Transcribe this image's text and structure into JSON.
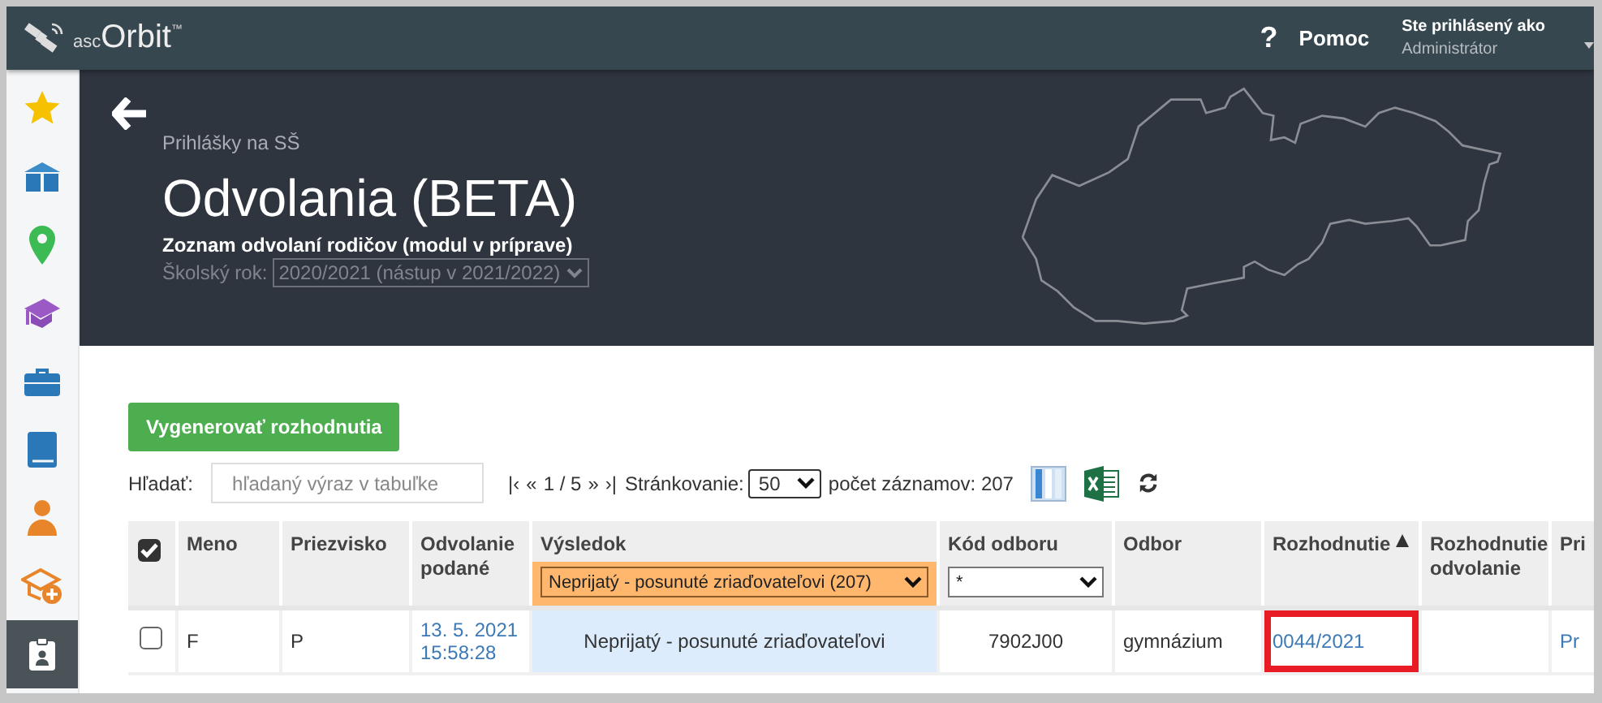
{
  "logo": {
    "prefix": "asc",
    "name": "Orbit",
    "mark": "™"
  },
  "topbar": {
    "help": {
      "icon_char": "?",
      "label": "Pomoc"
    },
    "user": {
      "caption": "Ste prihlásený ako",
      "name": "Administrátor"
    }
  },
  "sidebar": {
    "items": [
      {
        "kind": "star",
        "selected": false
      },
      {
        "kind": "book-open",
        "selected": false
      },
      {
        "kind": "pin",
        "selected": false
      },
      {
        "kind": "cap",
        "selected": false
      },
      {
        "kind": "briefcase",
        "selected": false
      },
      {
        "kind": "book",
        "selected": false
      },
      {
        "kind": "person",
        "selected": false
      },
      {
        "kind": "cap-plus",
        "selected": false
      },
      {
        "kind": "clipboard",
        "selected": true
      }
    ]
  },
  "header": {
    "breadcrumb": "Prihlášky na SŠ",
    "title": "Odvolania (BETA)",
    "subtitle": "Zoznam odvolaní rodičov (modul v príprave)",
    "school_year": {
      "label": "Školský rok:",
      "value": "2020/2021 (nástup v 2021/2022)",
      "disabled": true
    }
  },
  "toolbar": {
    "generate_button": "Vygenerovať rozhodnutia",
    "search": {
      "label": "Hľadať:",
      "placeholder": "hľadaný výraz v tabuľke"
    },
    "pager": {
      "first": "|‹",
      "prev": "«",
      "page": "1 / 5",
      "next": "»",
      "last": "›|"
    },
    "page_size": {
      "label": "Stránkovanie:",
      "value": "50"
    },
    "count": "počet záznamov: 207"
  },
  "table": {
    "select_all_checked": true,
    "columns": [
      {
        "label": "Meno",
        "kind": "text",
        "sorted": false
      },
      {
        "label": "Priezvisko",
        "kind": "text",
        "sorted": false
      },
      {
        "label": "Odvolanie podané",
        "kind": "link",
        "sorted": false
      },
      {
        "label": "Výsledok",
        "kind": "text",
        "sorted": false,
        "filter": {
          "value": "Neprijatý - posunuté zriaďovateľovi (207)",
          "active": true
        }
      },
      {
        "label": "Kód odboru",
        "kind": "code",
        "sorted": false,
        "filter": {
          "value": "*",
          "active": false
        }
      },
      {
        "label": "Odbor",
        "kind": "text",
        "sorted": false
      },
      {
        "label": "Rozhodnutie",
        "kind": "link",
        "sorted": true
      },
      {
        "label": "Rozhodnutie odvolanie",
        "kind": "text",
        "sorted": false
      },
      {
        "label": "Pri",
        "kind": "link",
        "sorted": false
      }
    ],
    "rows": [
      {
        "checked": false,
        "cells": [
          {
            "text": "F"
          },
          {
            "text": "P"
          },
          {
            "lines": [
              "13. 5. 2021",
              "15:58:28"
            ]
          },
          {
            "text": "Neprijatý - posunuté zriaďovateľovi"
          },
          {
            "text": "7902J00"
          },
          {
            "text": "gymnázium"
          },
          {
            "text": "0044/2021",
            "highlighted": true
          },
          {},
          {
            "text": "Pr"
          }
        ]
      }
    ]
  }
}
